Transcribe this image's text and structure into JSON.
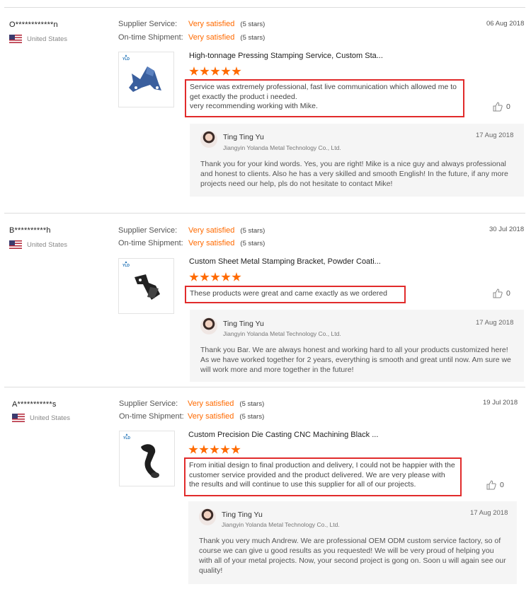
{
  "labels": {
    "supplier_service": "Supplier Service:",
    "ontime_shipment": "On-time Shipment:"
  },
  "reviews": [
    {
      "user": "O************n",
      "country": "United States",
      "date": "06 Aug 2018",
      "supplier_service": "Very satisfied",
      "supplier_stars": "(5 stars)",
      "ontime_shipment": "Very satisfied",
      "ontime_stars": "(5 stars)",
      "product_title": "High-tonnage Pressing Stamping Service, Custom Sta...",
      "rating": 5,
      "comment": "Service was extremely professional, fast live communication which allowed me to get exactly the product i needed.\nvery recommending working with Mike.",
      "likes": "0",
      "reply": {
        "name": "Ting Ting Yu",
        "company": "Jiangyin Yolanda Metal Technology Co., Ltd.",
        "date": "17 Aug 2018",
        "text": "Thank you for your kind words. Yes, you are right! Mike is a nice guy and always professional and honest to clients. Also he has a very skilled and smooth English! In the future, if any more projects need our help, pls do not hesitate to contact Mike!"
      }
    },
    {
      "user": "B**********h",
      "country": "United States",
      "date": "30 Jul 2018",
      "supplier_service": "Very satisfied",
      "supplier_stars": "(5 stars)",
      "ontime_shipment": "Very satisfied",
      "ontime_stars": "(5 stars)",
      "product_title": "Custom Sheet Metal Stamping Bracket, Powder Coati...",
      "rating": 5,
      "comment": "These products were great and came exactly as we ordered",
      "likes": "0",
      "reply": {
        "name": "Ting Ting Yu",
        "company": "Jiangyin Yolanda Metal Technology Co., Ltd.",
        "date": "17 Aug 2018",
        "text": "Thank you Bar. We are always honest and working hard to all your products customized here! As we have worked together for 2 years, everything is smooth and great until now. Am sure we will work more and more together in the future!"
      }
    },
    {
      "user": "A***********s",
      "country": "United States",
      "date": "19 Jul 2018",
      "supplier_service": "Very satisfied",
      "supplier_stars": "(5 stars)",
      "ontime_shipment": "Very satisfied",
      "ontime_stars": "(5 stars)",
      "product_title": "Custom Precision Die Casting CNC Machining Black ...",
      "rating": 5,
      "comment": "From initial design to final production and delivery, I could not be happier with the customer service provided and the product delivered. We are very please with the results and will continue to use this supplier for all of our projects.",
      "likes": "0",
      "reply": {
        "name": "Ting Ting Yu",
        "company": "Jiangyin Yolanda Metal Technology Co., Ltd.",
        "date": "17 Aug 2018",
        "text": "Thank you very much Andrew. We are professional OEM ODM custom service factory, so of course we can give u good results as you requested! We will be very proud of helping you with all of your metal projects. Now, your second project is gong on. Soon u will again see our quality!"
      }
    }
  ],
  "colors": {
    "accent": "#ff6a00",
    "highlight_border": "#e12b2b",
    "reply_bg": "#f5f5f5"
  },
  "icons": {
    "like": "thumbs-up-icon",
    "flag": "us-flag-icon"
  }
}
